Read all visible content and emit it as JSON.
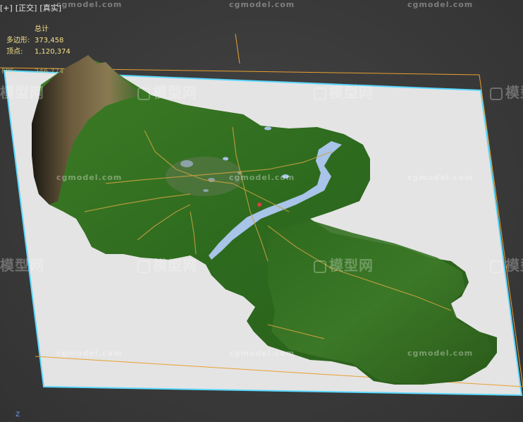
{
  "viewport": {
    "menu": [
      "[+]",
      "[正交]",
      "[真实]"
    ]
  },
  "stats": {
    "title": "总计",
    "polygons_label": "多边形:",
    "polygons_value": "373,458",
    "vertices_label": "顶点:",
    "vertices_value": "1,120,374",
    "fps_label": "FPS:",
    "fps_value": "246.774"
  },
  "axis_label": "Z",
  "watermark": {
    "cn": "模型网",
    "en": "cgmodel.com"
  },
  "colors": {
    "viewport_bg": "#3a3a3a",
    "ground_plane": "#e4e4e4",
    "plane_outline": "#5ad8ff",
    "bbox_outline": "#e8a030",
    "terrain_green": "#2f6a1c",
    "water": "#a8c4e8",
    "road": "#c8a040"
  }
}
